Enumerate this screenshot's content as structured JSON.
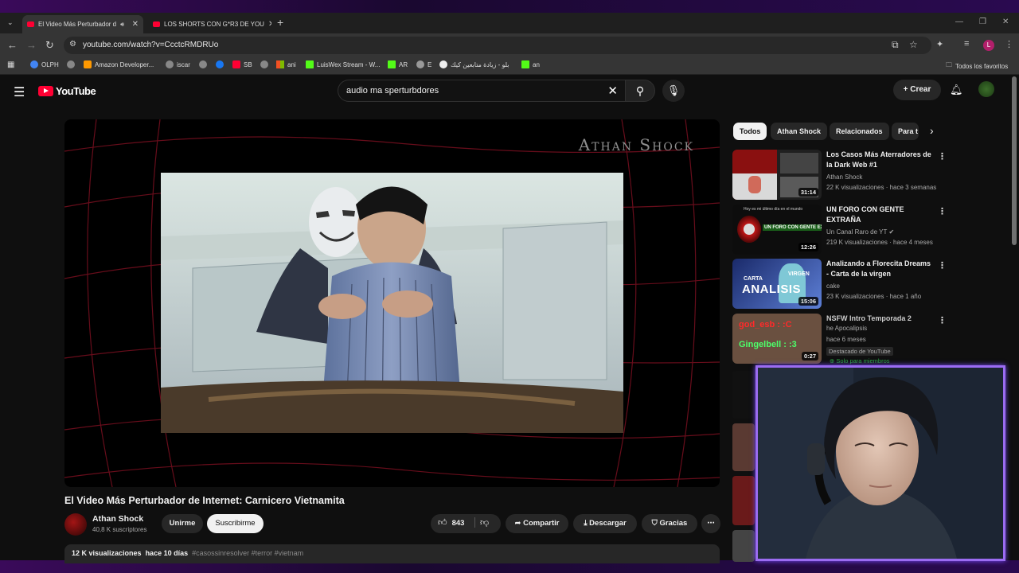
{
  "browser": {
    "tabs": [
      {
        "title": "El Video Más Perturbador d",
        "active": true
      },
      {
        "title": "LOS SHORTS CON G*R3 DE YOU",
        "active": false
      }
    ],
    "new_tab": "+",
    "url": "youtube.com/watch?v=CcctcRMDRUo",
    "profile_letter": "L",
    "bookmarks": [
      "OLPH",
      "Amazon Developer...",
      "iscar",
      "",
      "SB",
      "ani",
      "LuisWex Stream - W...",
      "AR",
      "E",
      "بلو - زيادة متابعين كيك",
      "an"
    ],
    "all_bookmarks": "Todos los favoritos"
  },
  "youtube": {
    "logo_text": "YouTube",
    "search_query": "audio ma sperturbdores",
    "create_label": "Crear"
  },
  "video": {
    "overlay_brand": "Athan Shock",
    "title": "El Video Más Perturbador de Internet: Carnicero Vietnamita",
    "channel": "Athan Shock",
    "subscribers": "40,8 K suscriptores",
    "join_label": "Unirme",
    "subscribe_label": "Suscribirme",
    "likes": "843",
    "share_label": "Compartir",
    "download_label": "Descargar",
    "thanks_label": "Gracias",
    "views": "12 K visualizaciones",
    "date": "hace 10 días",
    "tags": "#casossinresolver #terror #vietnam"
  },
  "chips": [
    "Todos",
    "Athan Shock",
    "Relacionados",
    "Para t"
  ],
  "recommendations": [
    {
      "title": "Los Casos Más Aterradores de la Dark Web #1",
      "channel": "Athan Shock",
      "meta": "22 K visualizaciones · hace 3 semanas",
      "duration": "31:14"
    },
    {
      "title": "UN FORO CON GENTE EXTRAÑA",
      "channel": "Un Canal Raro de YT",
      "meta": "219 K visualizaciones · hace 4 meses",
      "duration": "12:26"
    },
    {
      "title": "Analizando a Florecita Dreams - Carta de la virgen",
      "channel": "cake",
      "meta": "23 K visualizaciones · hace 1 año",
      "duration": "15:06"
    },
    {
      "title": "NSFW Intro Temporada 2",
      "channel": "he Apocalipsis",
      "meta": "hace 6 meses",
      "duration": "0:27",
      "badge": "Destacado de YouTube",
      "members": "Solo para miembros"
    }
  ],
  "thumb_text": {
    "r3_line1": "god_esb : :C",
    "r3_line2": "Gingelbell : :3",
    "r2_caption": "UN FORO CON GENTE EXTRAÑA",
    "r2_top": "Hoy es mi último día en el mundo",
    "r1_caption": "CARTA DE LA VIRGEN",
    "analisis": "ANALISIS",
    "carta": "CARTA",
    "virgen": "VIRGEN"
  },
  "colors": {
    "accent": "#ff0033",
    "cam_border": "#9b6cf2",
    "bg": "#0f0f0f"
  }
}
